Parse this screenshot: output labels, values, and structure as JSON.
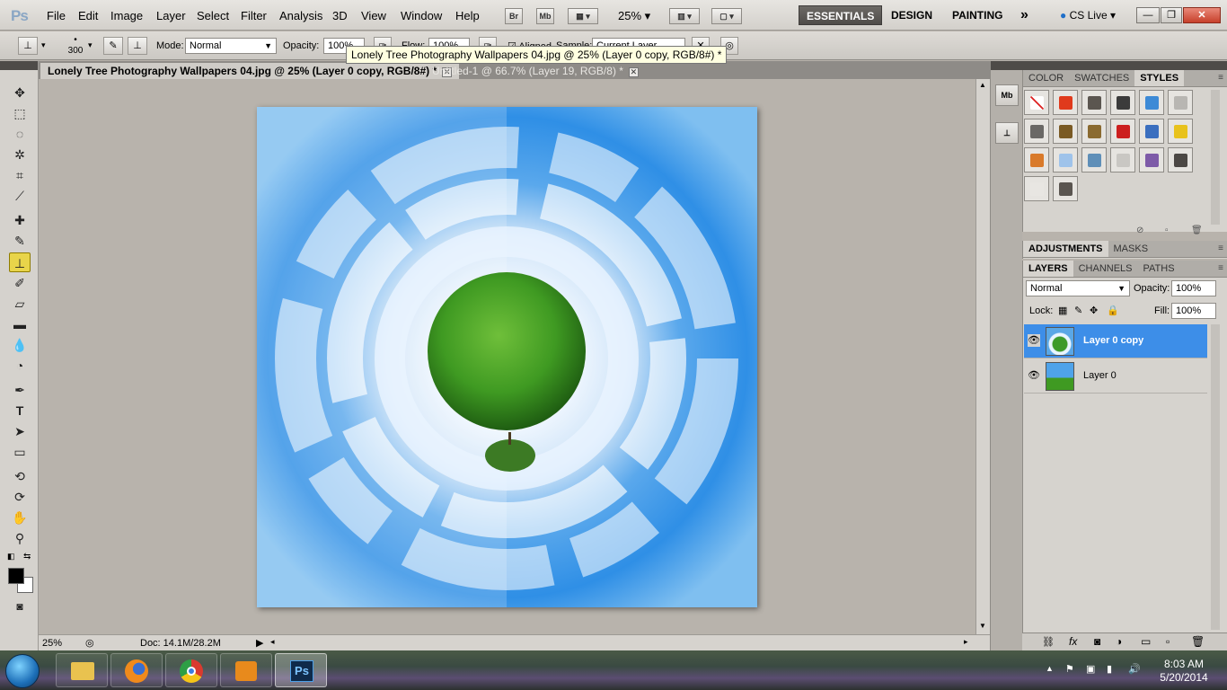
{
  "app": {
    "logo": "Ps",
    "menu": [
      "File",
      "Edit",
      "Image",
      "Layer",
      "Select",
      "Filter",
      "Analysis",
      "3D",
      "View",
      "Window",
      "Help"
    ],
    "bridge_btn": "Br",
    "minibridge_btn": "Mb",
    "zoom_level": "25%",
    "workspaces": [
      "ESSENTIALS",
      "DESIGN",
      "PAINTING"
    ],
    "active_workspace": "ESSENTIALS",
    "more_workspaces": "»",
    "cslive": "CS Live"
  },
  "options": {
    "brush_size": "300",
    "mode_label": "Mode:",
    "mode_value": "Normal",
    "opacity_label": "Opacity:",
    "opacity_value": "100%",
    "flow_label": "Flow:",
    "flow_value": "100%",
    "aligned_label": "Aligned",
    "sample_label": "Sample:",
    "sample_value": "Current Layer"
  },
  "tooltip": "Lonely Tree Photography Wallpapers 04.jpg @ 25% (Layer 0 copy, RGB/8#) *",
  "tabs": [
    {
      "label": "Lonely Tree Photography Wallpapers 04.jpg @ 25% (Layer 0 copy, RGB/8#) *",
      "active": true
    },
    {
      "label": "Untitled-1 @ 66.7% (Layer 19, RGB/8) *",
      "active": false
    }
  ],
  "status": {
    "zoom": "25%",
    "doc": "Doc: 14.1M/28.2M"
  },
  "panels": {
    "top_tabs": [
      "COLOR",
      "SWATCHES",
      "STYLES"
    ],
    "top_active": "STYLES",
    "mid_tabs": [
      "ADJUSTMENTS",
      "MASKS"
    ],
    "mid_active": "ADJUSTMENTS",
    "layers_tabs": [
      "LAYERS",
      "CHANNELS",
      "PATHS"
    ],
    "layers_active": "LAYERS",
    "blend_mode": "Normal",
    "opacity_label": "Opacity:",
    "opacity_value": "100%",
    "lock_label": "Lock:",
    "fill_label": "Fill:",
    "fill_value": "100%",
    "layers": [
      {
        "name": "Layer 0 copy",
        "selected": true
      },
      {
        "name": "Layer 0",
        "selected": false
      }
    ]
  },
  "style_colors": [
    "#ffffff",
    "#e03a1c",
    "#5b5650",
    "#3b3b3b",
    "#3d8ad6",
    "#b8b6b2",
    "#6a6865",
    "#7a5a24",
    "#8a6a30",
    "#cc1f1f",
    "#3b6fbf",
    "#e8c21c",
    "#d97a2a",
    "#9fc3ea",
    "#5f8fb8",
    "#c9c7c3",
    "#7e5ba8",
    "#4c4845",
    "#e8e6e2",
    "#5a5550"
  ],
  "taskbar": {
    "time": "8:03 AM",
    "date": "5/20/2014",
    "apps": [
      "explorer",
      "firefox",
      "chrome",
      "media-player",
      "photoshop"
    ]
  }
}
